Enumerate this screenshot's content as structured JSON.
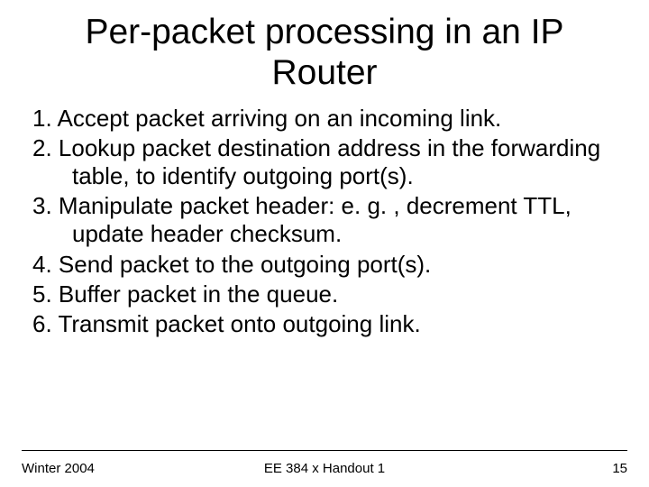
{
  "title_line1": "Per-packet processing in an IP",
  "title_line2": "Router",
  "items": [
    "1. Accept packet arriving on an incoming link.",
    "2. Lookup packet destination address in the forwarding table, to identify outgoing port(s).",
    "3. Manipulate packet header: e. g. , decrement TTL, update header checksum.",
    "4. Send packet to the outgoing port(s).",
    "5. Buffer packet in the queue.",
    "6. Transmit packet onto outgoing link."
  ],
  "footer": {
    "left": "Winter 2004",
    "center": "EE 384 x Handout 1",
    "right": "15"
  }
}
